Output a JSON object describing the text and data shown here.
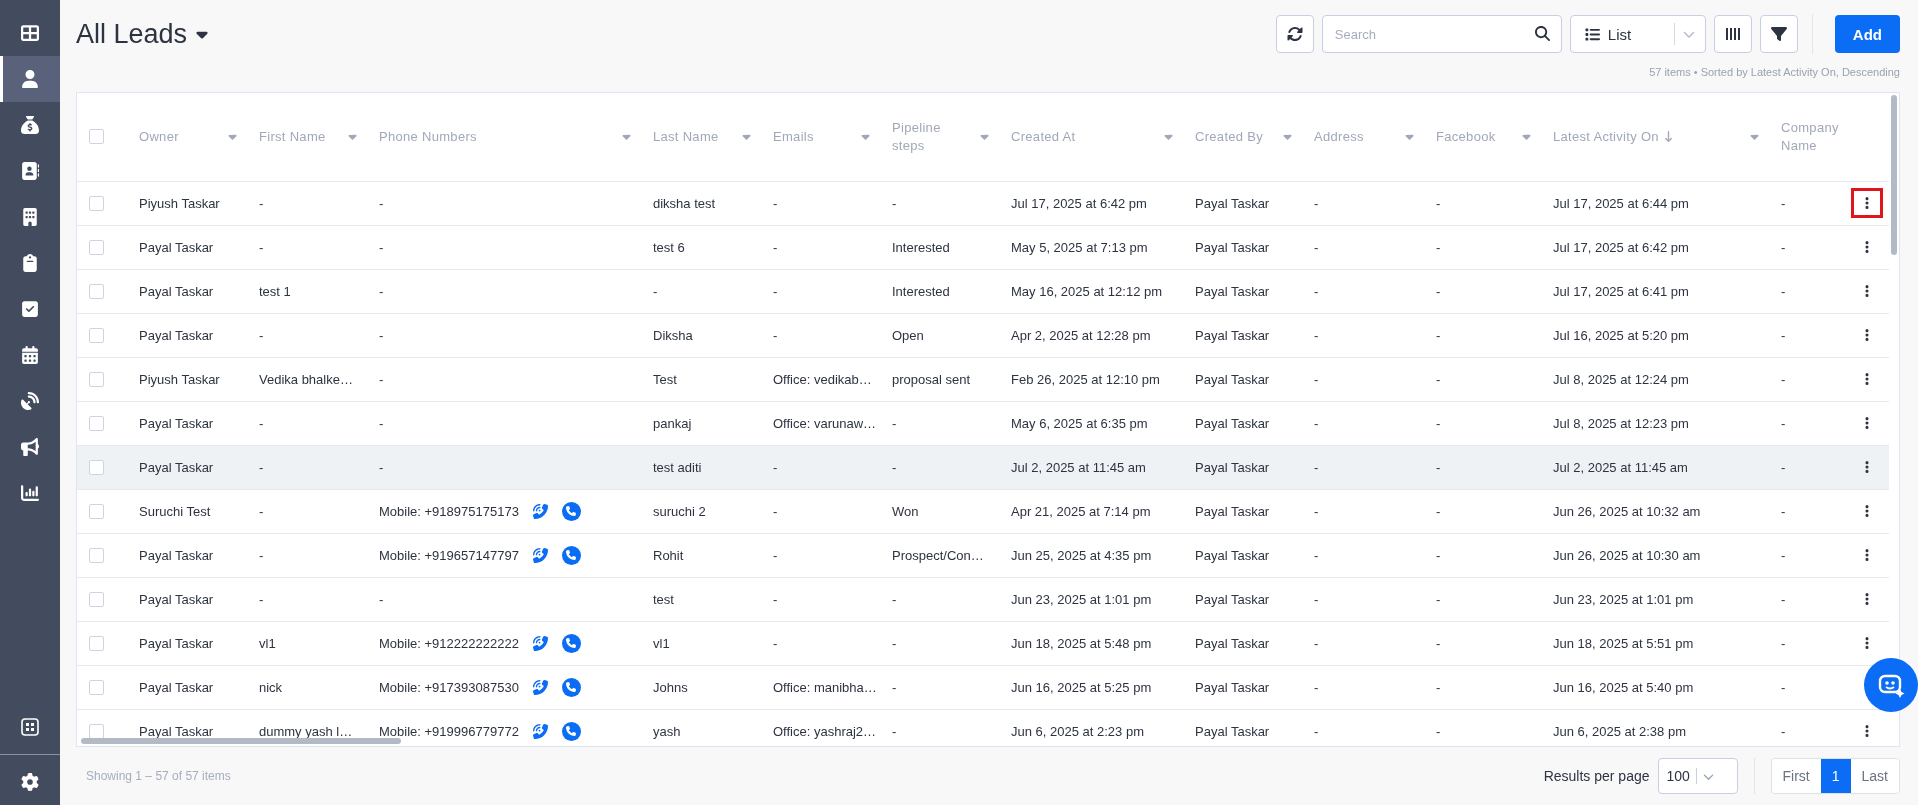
{
  "sidebar": {
    "items": [
      {
        "selected": false
      },
      {
        "selected": true
      },
      {
        "selected": false
      },
      {
        "selected": false
      },
      {
        "selected": false
      },
      {
        "selected": false
      },
      {
        "selected": false
      },
      {
        "selected": false
      },
      {
        "selected": false
      },
      {
        "selected": false
      },
      {
        "selected": false
      }
    ]
  },
  "header": {
    "title": "All Leads",
    "search": {
      "placeholder": "Search"
    },
    "view": {
      "value": "List"
    },
    "add_label": "Add",
    "summary": "57 items • Sorted by Latest Activity On, Descending"
  },
  "table": {
    "select_all_checked": false,
    "columns": [
      {
        "label": "Owner",
        "kind": "text",
        "menu": true,
        "sort_descending": false
      },
      {
        "label": "First Name",
        "kind": "text",
        "menu": true,
        "sort_descending": false
      },
      {
        "label": "Phone Numbers",
        "kind": "phone",
        "menu": true,
        "sort_descending": false
      },
      {
        "label": "Last Name",
        "kind": "text",
        "menu": true,
        "sort_descending": false
      },
      {
        "label": "Emails",
        "kind": "text",
        "menu": true,
        "sort_descending": false
      },
      {
        "label": "Pipeline steps",
        "kind": "text",
        "menu": true,
        "sort_descending": false
      },
      {
        "label": "Created At",
        "kind": "text",
        "menu": true,
        "sort_descending": false
      },
      {
        "label": "Created By",
        "kind": "text",
        "menu": true,
        "sort_descending": false
      },
      {
        "label": "Address",
        "kind": "text",
        "menu": true,
        "sort_descending": false
      },
      {
        "label": "Facebook",
        "kind": "text",
        "menu": true,
        "sort_descending": false
      },
      {
        "label": "Latest Activity On",
        "kind": "text",
        "menu": true,
        "sort_descending": true
      },
      {
        "label": "Company Name",
        "kind": "text",
        "menu": false,
        "sort_descending": false
      }
    ],
    "rows": [
      {
        "checked": false,
        "hovered": false,
        "menu_outlined": true,
        "call_buttons": false,
        "cells": [
          "Piyush Taskar",
          "-",
          "-",
          "diksha test",
          "-",
          "-",
          "Jul 17, 2025 at 6:42 pm",
          "Payal Taskar",
          "-",
          "-",
          "Jul 17, 2025 at 6:44 pm",
          "-"
        ]
      },
      {
        "checked": false,
        "hovered": false,
        "menu_outlined": false,
        "call_buttons": false,
        "cells": [
          "Payal Taskar",
          "-",
          "-",
          "test 6",
          "-",
          "Interested",
          "May 5, 2025 at 7:13 pm",
          "Payal Taskar",
          "-",
          "-",
          "Jul 17, 2025 at 6:42 pm",
          "-"
        ]
      },
      {
        "checked": false,
        "hovered": false,
        "menu_outlined": false,
        "call_buttons": false,
        "cells": [
          "Payal Taskar",
          "test 1",
          "-",
          "-",
          "-",
          "Interested",
          "May 16, 2025 at 12:12 pm",
          "Payal Taskar",
          "-",
          "-",
          "Jul 17, 2025 at 6:41 pm",
          "-"
        ]
      },
      {
        "checked": false,
        "hovered": false,
        "menu_outlined": false,
        "call_buttons": false,
        "cells": [
          "Payal Taskar",
          "-",
          "-",
          "Diksha",
          "-",
          "Open",
          "Apr 2, 2025 at 12:28 pm",
          "Payal Taskar",
          "-",
          "-",
          "Jul 16, 2025 at 5:20 pm",
          "-"
        ]
      },
      {
        "checked": false,
        "hovered": false,
        "menu_outlined": false,
        "call_buttons": false,
        "cells": [
          "Piyush Taskar",
          "Vedika bhalke…",
          "-",
          "Test",
          "Office: vedikab…",
          "proposal sent",
          "Feb 26, 2025 at 12:10 pm",
          "Payal Taskar",
          "-",
          "-",
          "Jul 8, 2025 at 12:24 pm",
          "-"
        ]
      },
      {
        "checked": false,
        "hovered": false,
        "menu_outlined": false,
        "call_buttons": false,
        "cells": [
          "Payal Taskar",
          "-",
          "-",
          "pankaj",
          "Office: varunaw…",
          "-",
          "May 6, 2025 at 6:35 pm",
          "Payal Taskar",
          "-",
          "-",
          "Jul 8, 2025 at 12:23 pm",
          "-"
        ]
      },
      {
        "checked": false,
        "hovered": true,
        "menu_outlined": false,
        "call_buttons": false,
        "cells": [
          "Payal Taskar",
          "-",
          "-",
          "test aditi",
          "-",
          "-",
          "Jul 2, 2025 at 11:45 am",
          "Payal Taskar",
          "-",
          "-",
          "Jul 2, 2025 at 11:45 am",
          "-"
        ]
      },
      {
        "checked": false,
        "hovered": false,
        "menu_outlined": false,
        "call_buttons": true,
        "cells": [
          "Suruchi Test",
          "-",
          "Mobile: +918975175173",
          "suruchi 2",
          "-",
          "Won",
          "Apr 21, 2025 at 7:14 pm",
          "Payal Taskar",
          "-",
          "-",
          "Jun 26, 2025 at 10:32 am",
          "-"
        ]
      },
      {
        "checked": false,
        "hovered": false,
        "menu_outlined": false,
        "call_buttons": true,
        "cells": [
          "Payal Taskar",
          "-",
          "Mobile: +919657147797",
          "Rohit",
          "-",
          "Prospect/Con…",
          "Jun 25, 2025 at 4:35 pm",
          "Payal Taskar",
          "-",
          "-",
          "Jun 26, 2025 at 10:30 am",
          "-"
        ]
      },
      {
        "checked": false,
        "hovered": false,
        "menu_outlined": false,
        "call_buttons": false,
        "cells": [
          "Payal Taskar",
          "-",
          "-",
          "test",
          "-",
          "-",
          "Jun 23, 2025 at 1:01 pm",
          "Payal Taskar",
          "-",
          "-",
          "Jun 23, 2025 at 1:01 pm",
          "-"
        ]
      },
      {
        "checked": false,
        "hovered": false,
        "menu_outlined": false,
        "call_buttons": true,
        "cells": [
          "Payal Taskar",
          "vl1",
          "Mobile: +912222222222",
          "vl1",
          "-",
          "-",
          "Jun 18, 2025 at 5:48 pm",
          "Payal Taskar",
          "-",
          "-",
          "Jun 18, 2025 at 5:51 pm",
          "-"
        ]
      },
      {
        "checked": false,
        "hovered": false,
        "menu_button": false,
        "call_buttons": true,
        "cells": [
          "Payal Taskar",
          "nick",
          "Mobile: +917393087530",
          "Johns",
          "Office: manibha…",
          "-",
          "Jun 16, 2025 at 5:25 pm",
          "Payal Taskar",
          "-",
          "-",
          "Jun 16, 2025 at 5:40 pm",
          "-"
        ]
      },
      {
        "checked": false,
        "hovered": false,
        "menu_outlined": false,
        "call_buttons": true,
        "cells": [
          "Payal Taskar",
          "dummy yash l…",
          "Mobile: +919996779772",
          "yash",
          "Office: yashraj2…",
          "-",
          "Jun 6, 2025 at 2:23 pm",
          "Payal Taskar",
          "-",
          "-",
          "Jun 6, 2025 at 2:38 pm",
          "-"
        ]
      }
    ]
  },
  "footer": {
    "showing": "Showing 1 – 57 of 57 items",
    "per_page_label": "Results per page",
    "per_page": "100",
    "pages": [
      {
        "label": "First",
        "selected": false
      },
      {
        "label": "1",
        "selected": true
      },
      {
        "label": "Last",
        "selected": false
      }
    ]
  }
}
